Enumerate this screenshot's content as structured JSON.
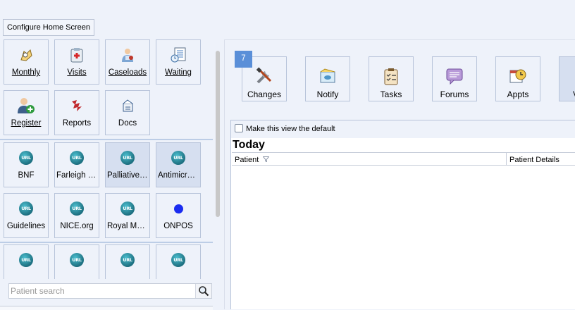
{
  "toolbar": {
    "configure_label": "Configure Home Screen"
  },
  "left_tiles": [
    {
      "label": "Monthly",
      "icon": "monthly-icon"
    },
    {
      "label": "Visits",
      "icon": "visits-icon"
    },
    {
      "label": "Caseloads",
      "icon": "caseloads-icon"
    },
    {
      "label": "Waiting",
      "icon": "waiting-icon"
    },
    {
      "label": "Register",
      "icon": "register-icon"
    },
    {
      "label": "Reports",
      "icon": "reports-icon"
    },
    {
      "label": "Docs",
      "icon": "docs-icon"
    }
  ],
  "url_tiles": [
    {
      "label": "BNF",
      "icon": "url-globe-icon"
    },
    {
      "label": "Farleigh Hospice",
      "icon": "url-globe-icon"
    },
    {
      "label": "Palliative Care",
      "icon": "url-globe-icon"
    },
    {
      "label": "Antimicrobial",
      "icon": "url-globe-icon"
    },
    {
      "label": "Guidelines",
      "icon": "url-globe-icon"
    },
    {
      "label": "NICE.org",
      "icon": "url-globe-icon"
    },
    {
      "label": "Royal Marsden",
      "icon": "url-globe-icon"
    },
    {
      "label": "ONPOS",
      "icon": "blue-dot-icon"
    }
  ],
  "url_icon_text": "URL",
  "search": {
    "placeholder": "Patient search"
  },
  "right": {
    "badge": "7",
    "tiles": [
      {
        "label": "Changes",
        "icon": "changes-icon"
      },
      {
        "label": "Notify",
        "icon": "notify-icon"
      },
      {
        "label": "Tasks",
        "icon": "tasks-icon"
      },
      {
        "label": "Forums",
        "icon": "forums-icon"
      },
      {
        "label": "Appts",
        "icon": "appts-icon"
      },
      {
        "label": "V",
        "icon": "view-icon"
      }
    ]
  },
  "view": {
    "default_checkbox_label": "Make this view the default",
    "default_checked": false,
    "section_title": "Today",
    "columns": [
      "Patient",
      "Patient Details"
    ]
  },
  "colors": {
    "accent": "#5a8fd8",
    "background": "#eef2fa",
    "tile_border": "#b8c4da",
    "selected_tile": "#d6dff0"
  }
}
